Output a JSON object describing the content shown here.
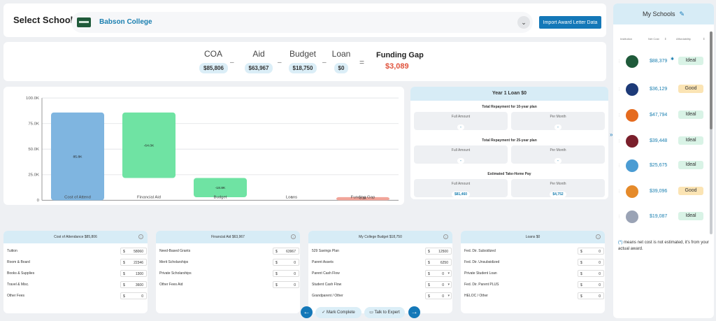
{
  "header": {
    "select_label": "Select School:",
    "school_name": "Babson College",
    "import_button": "Import Award Letter Data"
  },
  "summary": {
    "coa_label": "COA",
    "coa_value": "$85,806",
    "aid_label": "Aid",
    "aid_value": "$63,967",
    "budget_label": "Budget",
    "budget_value": "$18,750",
    "loan_label": "Loan",
    "loan_value": "$0",
    "minus": "–",
    "equals": "=",
    "gap_label": "Funding Gap",
    "gap_value": "$3,089"
  },
  "chart_data": {
    "type": "bar",
    "subtype": "waterfall",
    "categories": [
      "Cost of Attend",
      "Financial Aid",
      "Budget",
      "Loans",
      "Funding Gap"
    ],
    "values": [
      85.8,
      -64.0,
      -18.8,
      0,
      3.1
    ],
    "bar_ranges": [
      [
        0,
        85.8
      ],
      [
        21.8,
        85.8
      ],
      [
        3.0,
        21.8
      ],
      [
        0,
        0
      ],
      [
        0,
        3.1
      ]
    ],
    "data_labels": [
      "85.8K",
      "-64.0K",
      "-18.8K",
      "0",
      "3.1K"
    ],
    "colors": [
      "#7fb5e0",
      "#6fe3a3",
      "#6fe3a3",
      "#6fe3a3",
      "#f2a59a"
    ],
    "yticks": [
      "0",
      "25.0K",
      "50.0K",
      "75.0K",
      "100.0K"
    ],
    "ylim": [
      0,
      100
    ],
    "grid": true,
    "title": "",
    "xlabel": "",
    "ylabel": ""
  },
  "loan_panel": {
    "title": "Year 1 Loan $0",
    "sections": [
      {
        "title": "Total Repayment for 10-year plan",
        "full_label": "Full Amount",
        "full_value": "-",
        "month_label": "Per Month",
        "month_value": "-"
      },
      {
        "title": "Total Repayment for 25-year plan",
        "full_label": "Full Amount",
        "full_value": "-",
        "month_label": "Per Month",
        "month_value": "-"
      },
      {
        "title": "Estimated Take-Home Pay",
        "full_label": "Full Amount",
        "full_value": "$81,460",
        "month_label": "Per Month",
        "month_value": "$4,752"
      }
    ]
  },
  "panels": [
    {
      "title": "Cost of Attendance $85,806",
      "rows": [
        {
          "name": "Tuition",
          "value": "58060"
        },
        {
          "name": "Room & Board",
          "value": "22346"
        },
        {
          "name": "Books & Supplies",
          "value": "1300"
        },
        {
          "name": "Travel & Misc.",
          "value": "3600"
        },
        {
          "name": "Other Fees",
          "value": "0"
        }
      ]
    },
    {
      "title": "Financial Aid $63,967",
      "rows": [
        {
          "name": "Need-Based Grants",
          "value": "63967"
        },
        {
          "name": "Merit Scholarships",
          "value": "0"
        },
        {
          "name": "Private Scholarships",
          "value": "0"
        },
        {
          "name": "Other Fees Aid",
          "value": "0"
        }
      ]
    },
    {
      "title": "My College Budget $18,750",
      "rows": [
        {
          "name": "529 Savings Plan",
          "value": "12500"
        },
        {
          "name": "Parent Assets",
          "value": "6250"
        },
        {
          "name": "Parent Cash Flow",
          "value": "0"
        },
        {
          "name": "Student Cash Flow",
          "value": "0"
        },
        {
          "name": "Grandparent / Other",
          "value": "0"
        }
      ]
    },
    {
      "title": "Loans $0",
      "rows": [
        {
          "name": "Fed. Dir. Subsidized",
          "value": "0"
        },
        {
          "name": "Fed. Dir. Unsubsidized",
          "value": "0"
        },
        {
          "name": "Private Student Loan",
          "value": "0"
        },
        {
          "name": "Fed. Dir. Parent PLUS",
          "value": "0"
        },
        {
          "name": "HELOC / Other",
          "value": "0"
        }
      ]
    }
  ],
  "currency": "$",
  "footer": {
    "mark_complete": "Mark Complete",
    "talk_expert": "Talk to Expert"
  },
  "sidebar": {
    "title": "My Schools",
    "col_institution": "Institution",
    "col_net_cost": "Net Cost",
    "col_affordability": "Affordability",
    "schools": [
      {
        "cost": "$88,379",
        "star": true,
        "badge": "Ideal",
        "color": "#1f5a3a"
      },
      {
        "cost": "$36,129",
        "star": false,
        "badge": "Good",
        "color": "#1d3a78"
      },
      {
        "cost": "$47,794",
        "star": false,
        "badge": "Ideal",
        "color": "#e56b1f"
      },
      {
        "cost": "$39,448",
        "star": false,
        "badge": "Ideal",
        "color": "#7a1f2b"
      },
      {
        "cost": "$25,675",
        "star": false,
        "badge": "Ideal",
        "color": "#4b9cd3"
      },
      {
        "cost": "$39,096",
        "star": false,
        "badge": "Good",
        "color": "#e58a2a"
      },
      {
        "cost": "$19,087",
        "star": false,
        "badge": "Ideal",
        "color": "#9aa3b5"
      }
    ],
    "note_mark": "(*)",
    "note_text": " means net cost is not estimated, it's from your actual award."
  }
}
